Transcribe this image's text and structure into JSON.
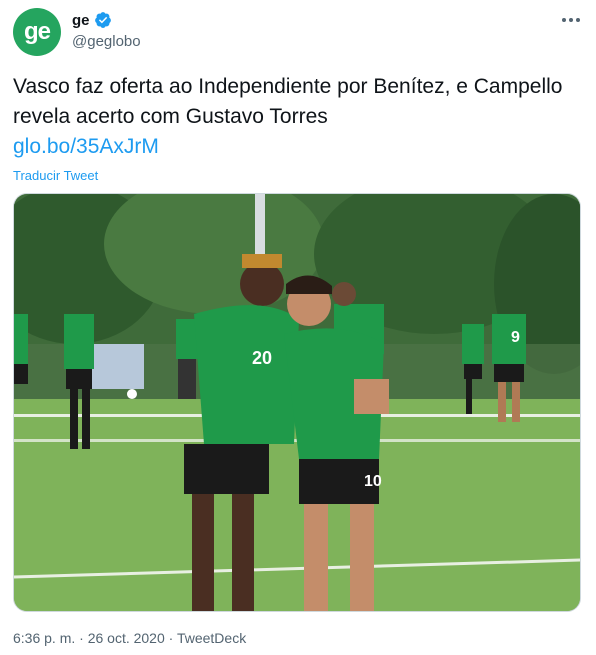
{
  "account": {
    "avatar_text": "ge",
    "display_name": "ge",
    "handle": "@geglobo"
  },
  "tweet": {
    "text": "Vasco faz oferta ao Independiente por Benítez, e Campello revela acerto com Gustavo Torres",
    "link": "glo.bo/35AxJrM",
    "translate_label": "Traducir Tweet"
  },
  "media": {
    "player_left_number": "20",
    "player_right_number": "10",
    "background_player_number": "9"
  },
  "meta": {
    "timestamp": "6:36 p. m. · 26 oct. 2020 · TweetDeck"
  },
  "colors": {
    "brand": "#25a55f",
    "link": "#1d9bf0",
    "text": "#0f1419",
    "secondary": "#536471",
    "jersey": "#1f9a4a",
    "grass": "#7fb35a"
  }
}
